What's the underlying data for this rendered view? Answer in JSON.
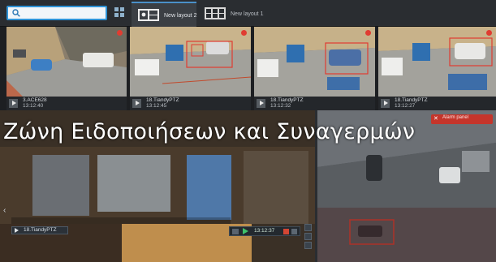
{
  "search": {
    "value": "",
    "placeholder": ""
  },
  "tabs": [
    {
      "label": "New layout 2",
      "active": true
    },
    {
      "label": "New layout 1",
      "active": false
    }
  ],
  "cameras": [
    {
      "name": "3.ACE628",
      "time": "13:12:40",
      "selected": true
    },
    {
      "name": "18.TiandyPTZ",
      "time": "13:12:45",
      "selected": false
    },
    {
      "name": "18.TiandyPTZ",
      "time": "13:12:32",
      "selected": false
    },
    {
      "name": "18.TiandyPTZ",
      "time": "13:12:27",
      "selected": false
    }
  ],
  "headline": "Ζώνη Ειδοποιήσεων και Συναγερμών",
  "lower": {
    "panel_label": "Alarm panel",
    "camera_label": "18.TiandyPTZ",
    "control_time": "13:12:37"
  },
  "colors": {
    "accent": "#2f93d6",
    "alarm": "#e03c31",
    "selection": "#c8582c",
    "background": "#1d1f22"
  }
}
